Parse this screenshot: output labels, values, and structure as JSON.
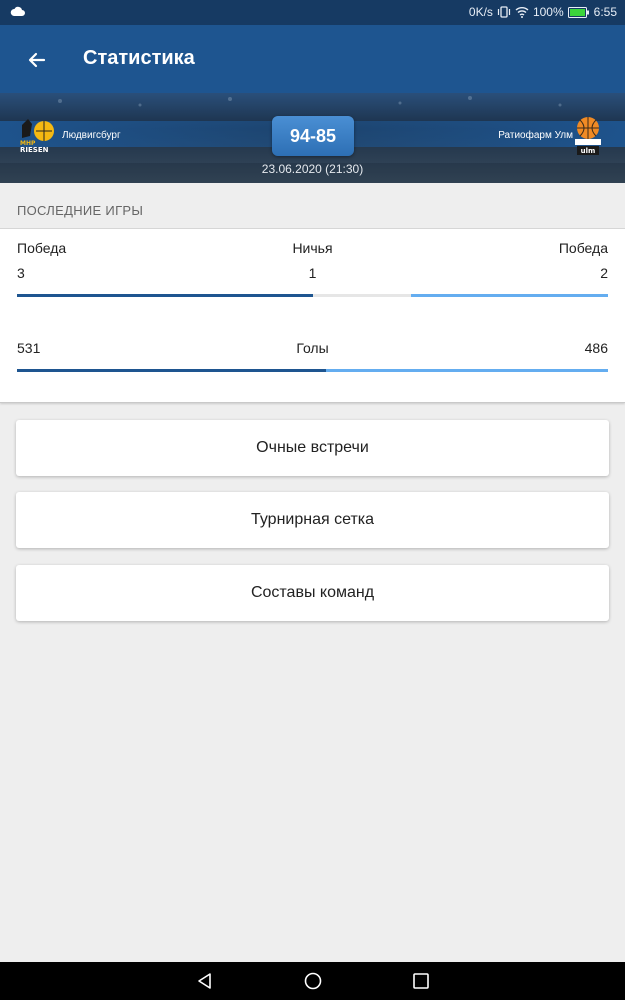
{
  "status_bar": {
    "network_speed": "0K/s",
    "battery_percent": "100%",
    "time": "6:55",
    "icons": [
      "cloud-icon",
      "vibrate-icon",
      "wifi-icon",
      "battery-icon"
    ]
  },
  "app_bar": {
    "title": "Статистика",
    "back_icon": "arrow-left-icon"
  },
  "match": {
    "home_team": "Людвигсбург",
    "away_team": "Ратиофарм Улм",
    "score": "94-85",
    "date": "23.06.2020 (21:30)",
    "home_logo_text": "MHP RIESEN",
    "away_logo_text": "ulm"
  },
  "recent_games": {
    "header": "ПОСЛЕДНИЕ ИГРЫ",
    "home_win_label": "Победа",
    "draw_label": "Ничья",
    "away_win_label": "Победа",
    "home_wins": "3",
    "draws": "1",
    "away_wins": "2",
    "goals_label": "Голы",
    "home_goals": "531",
    "away_goals": "486"
  },
  "actions": {
    "head_to_head": "Очные встречи",
    "tournament_bracket": "Турнирная сетка",
    "team_rosters": "Составы команд"
  },
  "colors": {
    "app_bar": "#1e5590",
    "home_bar": "#1e5590",
    "away_bar": "#64adf0",
    "draw_bar": "#e6e6e6"
  }
}
